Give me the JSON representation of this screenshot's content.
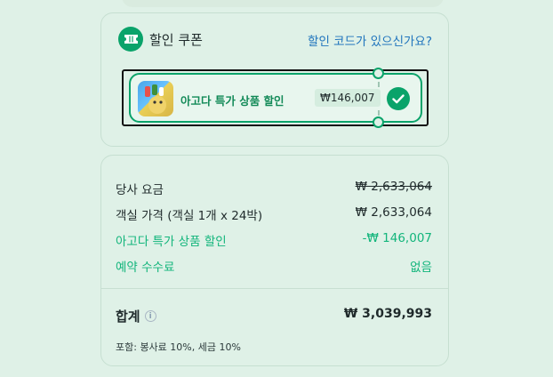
{
  "coupon": {
    "title": "할인 쿠폰",
    "link_label": "할인 코드가 있으신가요?",
    "icon": "ticket-icon",
    "item": {
      "name": "아고다 특가 상품 할인",
      "amount": "₩146,007",
      "thumbnail": "coupon-thumbnail",
      "selected": true
    }
  },
  "summary": {
    "rows": [
      {
        "label": "당사 요금",
        "value": "₩ 2,633,064",
        "struck": true
      },
      {
        "label": "객실 가격 (객실 1개 x 24박)",
        "value": "₩ 2,633,064"
      },
      {
        "label": "아고다 특가 상품 할인",
        "value": "-₩ 146,007"
      },
      {
        "label": "예약 수수료",
        "value": "없음"
      }
    ],
    "total_label": "합계",
    "info_icon": "i",
    "total_value": "₩ 3,039,993",
    "tax_note": "포함: 봉사료 10%, 세금 10%"
  },
  "colors": {
    "accent_green": "#0aa36a",
    "discount_green": "#12b57b",
    "link_blue": "#1f74bd",
    "background": "#dff1e7"
  }
}
